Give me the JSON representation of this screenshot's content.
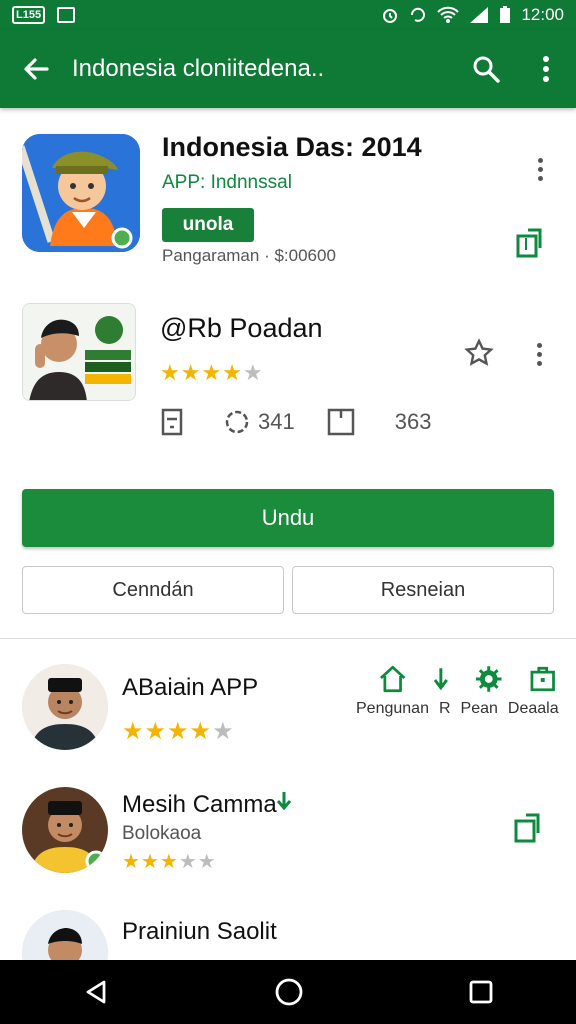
{
  "status_bar": {
    "notif_label": "L155",
    "time": "12:00"
  },
  "app_bar": {
    "title": "Indonesia cloniitedena..",
    "icons": [
      "back-arrow-icon",
      "search-icon",
      "more-vert-icon"
    ]
  },
  "app_header": {
    "title": "Indonesia Das: 2014",
    "subtitle": "APP: Indnnssal",
    "badge": "unola",
    "meta": "Pangaraman · $:00600"
  },
  "app_second": {
    "title": "@Rb Poadan",
    "rating": 4,
    "stats": [
      {
        "icon": "document-icon",
        "value": ""
      },
      {
        "icon": "gauge-icon",
        "value": "341"
      },
      {
        "icon": "square-icon",
        "value": ""
      },
      {
        "icon": "",
        "value": "363"
      }
    ]
  },
  "actions": {
    "primary": "Undu",
    "secondary_left": "Cenndán",
    "secondary_right": "Resneian"
  },
  "list": [
    {
      "title": "ABaiain APP",
      "subtitle": "",
      "rating": 4
    },
    {
      "title": "Mesih Camma",
      "subtitle": "Bolokaoa",
      "rating": 3.5
    },
    {
      "title": "Prainiun Saolit",
      "subtitle": "",
      "rating": 0
    }
  ],
  "categories": {
    "labels": [
      "Pengunan",
      "R",
      "Pean",
      "Deaala"
    ]
  },
  "colors": {
    "primary": "#0e7a35",
    "button": "#1a8c3c",
    "star": "#f4b400"
  }
}
